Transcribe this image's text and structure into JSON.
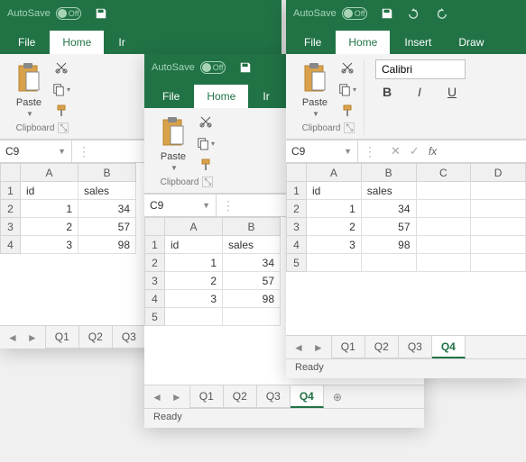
{
  "common": {
    "autosave_label": "AutoSave",
    "autosave_state": "Off",
    "menu_file": "File",
    "menu_home": "Home",
    "menu_insert": "Insert",
    "menu_draw": "Draw",
    "paste_label": "Paste",
    "clipboard_label": "Clipboard",
    "name_box_value": "C9",
    "status_ready": "Ready",
    "font_name": "Calibri",
    "font_bold": "B",
    "font_italic": "I",
    "font_underline": "U",
    "fx_label": "fx",
    "sheet_tabs": [
      "Q1",
      "Q2",
      "Q3",
      "Q4"
    ],
    "active_sheet": "Q4",
    "columns": [
      "A",
      "B",
      "C",
      "D"
    ],
    "headers": {
      "id": "id",
      "sales": "sales"
    },
    "rows": [
      {
        "id": 1,
        "sales": 34
      },
      {
        "id": 2,
        "sales": 57
      },
      {
        "id": 3,
        "sales": 98
      }
    ]
  }
}
